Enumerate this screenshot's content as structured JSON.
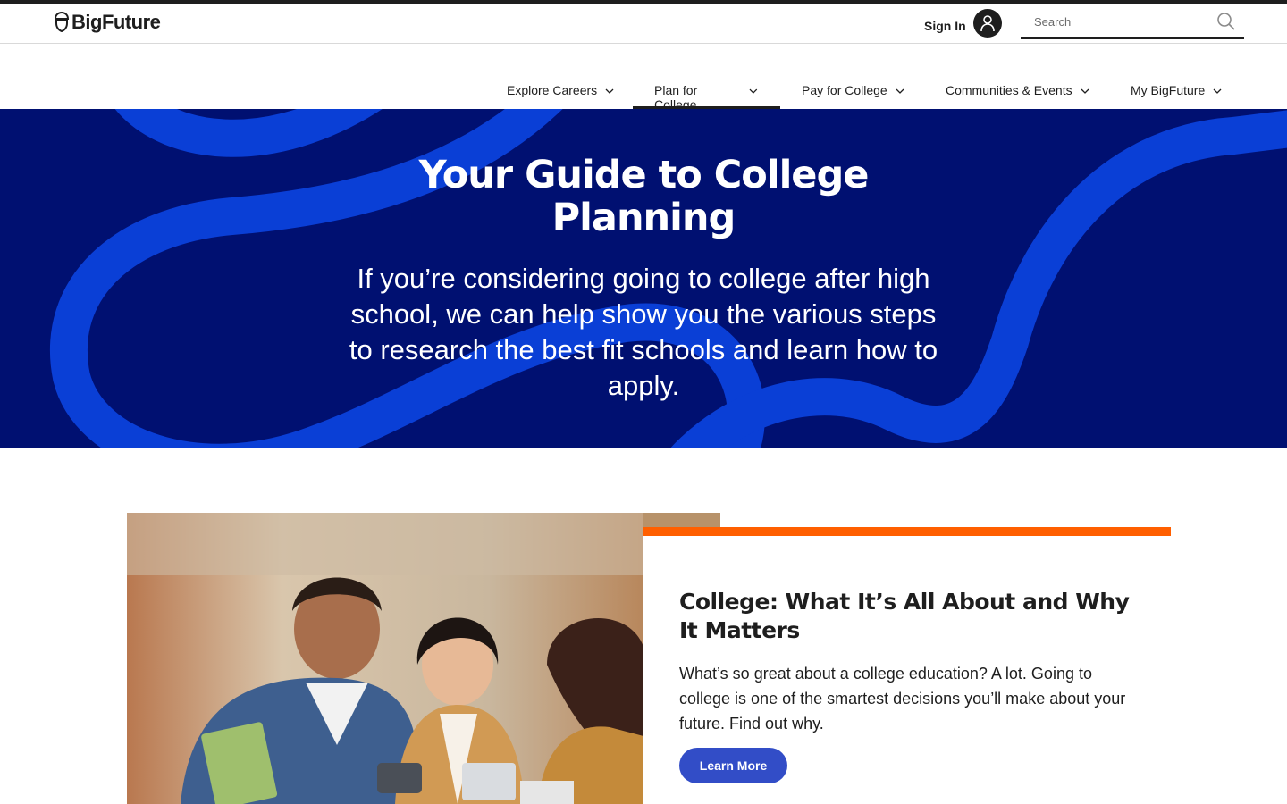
{
  "header": {
    "logo_text": "BigFuture",
    "signin_label": "Sign In",
    "search_placeholder": "Search"
  },
  "nav": {
    "items": [
      {
        "label": "Explore Careers"
      },
      {
        "label": "Plan for College",
        "active": true
      },
      {
        "label": "Pay for College"
      },
      {
        "label": "Communities & Events"
      },
      {
        "label": "My BigFuture"
      }
    ]
  },
  "hero": {
    "title": "Your Guide to College Planning",
    "subtitle": "If you’re considering going to college after high school, we can help show you the various steps to research the best fit schools and learn how to apply."
  },
  "feature_card": {
    "title": "College: What It’s All About and Why It Matters",
    "text": "What’s so great about a college education? A lot. Going to college is one of the smartest decisions you’ll make about your future. Find out why.",
    "button_label": "Learn More"
  },
  "colors": {
    "hero_bg": "#001071",
    "hero_wave": "#0a3fd6",
    "accent_orange": "#ff5f00",
    "button_blue": "#324dc7"
  },
  "icons": {
    "logo": "acorn-icon",
    "avatar": "user-icon",
    "search": "search-icon",
    "dropdown": "chevron-down-icon"
  }
}
